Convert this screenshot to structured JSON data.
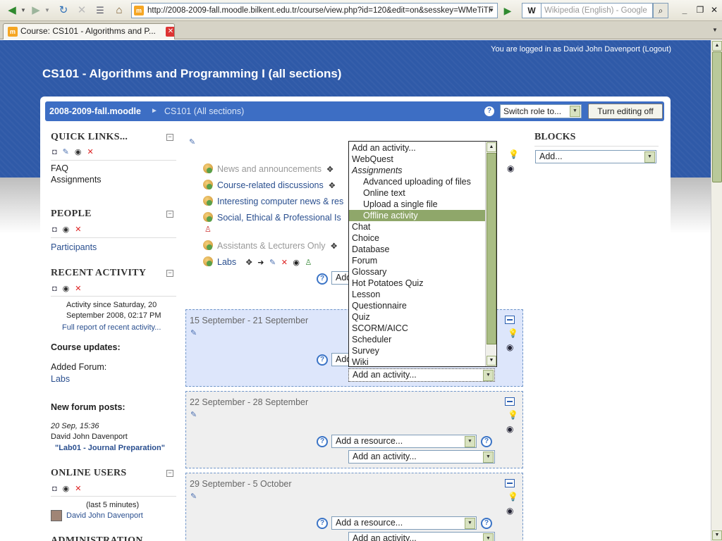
{
  "browser": {
    "url": "http://2008-2009-fall.moodle.bilkent.edu.tr/course/view.php?id=120&edit=on&sesskey=WMeTiTF",
    "search_placeholder": "Wikipedia (English) - Google",
    "search_engine_icon": "W",
    "tab_title": "Course: CS101 - Algorithms and P...",
    "favicon": "m"
  },
  "header": {
    "login_info": "You are logged in as David John Davenport (Logout)",
    "course_title": "CS101 - Algorithms and Programming I (all sections)"
  },
  "navbar": {
    "home": "2008-2009-fall.moodle",
    "separator": "►",
    "course": "CS101 (All sections)",
    "switch_role": "Switch role to...",
    "turn_editing": "Turn editing off"
  },
  "left_blocks": {
    "quick_links": {
      "title": "QUICK LINKS...",
      "items": [
        "FAQ",
        "Assignments"
      ]
    },
    "people": {
      "title": "PEOPLE",
      "items": [
        "Participants"
      ]
    },
    "recent_activity": {
      "title": "RECENT ACTIVITY",
      "since_line1": "Activity since Saturday, 20",
      "since_line2": "September 2008, 02:17 PM",
      "full_report": "Full report of recent activity...",
      "course_updates": "Course updates:",
      "added_forum": "Added Forum:",
      "added_forum_name": "Labs",
      "new_posts": "New forum posts:",
      "post_date": "20 Sep, 15:36",
      "post_author": "David John Davenport",
      "post_title": "\"Lab01 - Journal Preparation\""
    },
    "online_users": {
      "title": "ONLINE USERS",
      "window": "(last 5 minutes)",
      "user": "David John Davenport"
    },
    "administration": {
      "title": "ADMINISTRATION"
    }
  },
  "topic0": {
    "activities": [
      {
        "label": "News and announcements",
        "dim": true
      },
      {
        "label": "Course-related discussions",
        "dim": false
      },
      {
        "label": "Interesting computer news & res",
        "dim": false
      },
      {
        "label": "Social, Ethical & Professional Is",
        "dim": false
      },
      {
        "label": "Assistants & Lecturers Only",
        "dim": true
      },
      {
        "label": "Labs",
        "dim": false
      }
    ],
    "add_resource_partial": "Add"
  },
  "sections": [
    {
      "title": "15 September - 21 September",
      "add_resource": "Add",
      "add_activity": "Add an activity..."
    },
    {
      "title": "22 September - 28 September",
      "add_resource": "Add a resource...",
      "add_activity": "Add an activity..."
    },
    {
      "title": "29 September - 5 October",
      "add_resource": "Add a resource...",
      "add_activity": "Add an activity..."
    }
  ],
  "activity_dropdown": {
    "selected": "Offline activity",
    "options": [
      {
        "label": "Add an activity...",
        "type": "normal"
      },
      {
        "label": "WebQuest",
        "type": "normal"
      },
      {
        "label": "Assignments",
        "type": "group"
      },
      {
        "label": "Advanced uploading of files",
        "type": "indent"
      },
      {
        "label": "Online text",
        "type": "indent"
      },
      {
        "label": "Upload a single file",
        "type": "indent"
      },
      {
        "label": "Offline activity",
        "type": "selected"
      },
      {
        "label": "Chat",
        "type": "normal"
      },
      {
        "label": "Choice",
        "type": "normal"
      },
      {
        "label": "Database",
        "type": "normal"
      },
      {
        "label": "Forum",
        "type": "normal"
      },
      {
        "label": "Glossary",
        "type": "normal"
      },
      {
        "label": "Hot Potatoes Quiz",
        "type": "normal"
      },
      {
        "label": "Lesson",
        "type": "normal"
      },
      {
        "label": "Questionnaire",
        "type": "normal"
      },
      {
        "label": "Quiz",
        "type": "normal"
      },
      {
        "label": "SCORM/AICC",
        "type": "normal"
      },
      {
        "label": "Scheduler",
        "type": "normal"
      },
      {
        "label": "Survey",
        "type": "normal"
      },
      {
        "label": "Wiki",
        "type": "normal"
      }
    ]
  },
  "right_blocks": {
    "title": "BLOCKS",
    "add": "Add..."
  },
  "colors": {
    "header_blue": "#2f5aa8",
    "navbar_blue": "#3d6ec4",
    "selected_green": "#8fa76a",
    "section_bg": "#dde6fb"
  }
}
